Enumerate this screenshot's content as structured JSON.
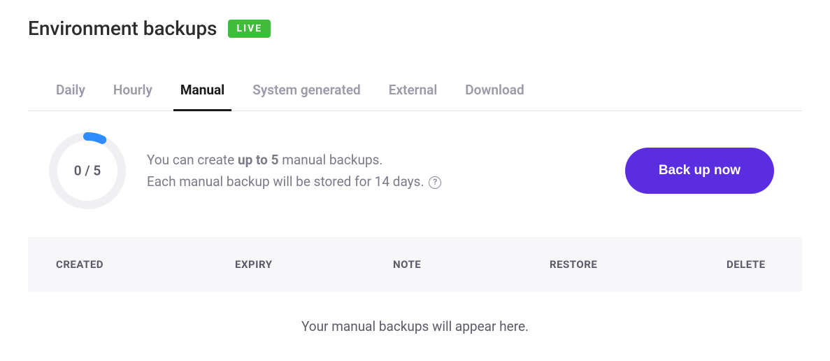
{
  "header": {
    "title": "Environment backups",
    "badge": "LIVE"
  },
  "tabs": [
    {
      "label": "Daily",
      "active": false
    },
    {
      "label": "Hourly",
      "active": false
    },
    {
      "label": "Manual",
      "active": true
    },
    {
      "label": "System generated",
      "active": false
    },
    {
      "label": "External",
      "active": false
    },
    {
      "label": "Download",
      "active": false
    }
  ],
  "progress": {
    "used": 0,
    "total": 5,
    "label": "0 / 5"
  },
  "info": {
    "line1_prefix": "You can create ",
    "line1_strong": "up to 5",
    "line1_suffix": " manual backups.",
    "line2": "Each manual backup will be stored for 14 days.",
    "help_glyph": "?"
  },
  "actions": {
    "backup_now": "Back up now"
  },
  "table": {
    "columns": {
      "created": "CREATED",
      "expiry": "EXPIRY",
      "note": "NOTE",
      "restore": "RESTORE",
      "delete": "DELETE"
    },
    "empty_message": "Your manual backups will appear here."
  }
}
